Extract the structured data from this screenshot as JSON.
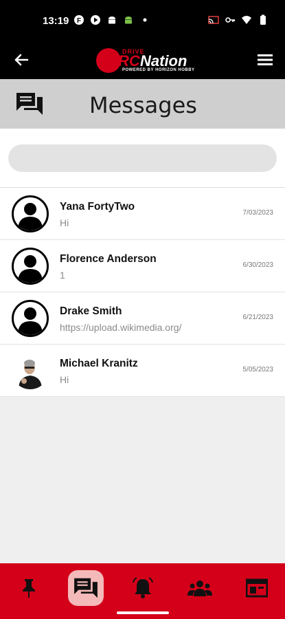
{
  "status_bar": {
    "time": "13:19"
  },
  "header": {
    "logo": {
      "drive": "DRIVE",
      "rc": "RC",
      "nation": "Nation",
      "powered": "POWERED BY HORIZON HOBBY"
    }
  },
  "page": {
    "title": "Messages"
  },
  "search": {
    "value": "",
    "placeholder": ""
  },
  "conversations": [
    {
      "name": "Yana FortyTwo",
      "preview": "Hi",
      "date": "7/03/2023",
      "avatar": "default-avatar"
    },
    {
      "name": "Florence Anderson",
      "preview": "1",
      "date": "6/30/2023",
      "avatar": "default-avatar"
    },
    {
      "name": "Drake Smith",
      "preview": "https://upload.wikimedia.org/",
      "date": "6/21/2023",
      "avatar": "default-avatar"
    },
    {
      "name": "Michael Kranitz",
      "preview": "Hi",
      "date": "5/05/2023",
      "avatar": "photo-avatar"
    }
  ],
  "bottom_nav": {
    "items": [
      {
        "icon": "pin-icon",
        "active": false
      },
      {
        "icon": "messages-icon",
        "active": true
      },
      {
        "icon": "bell-icon",
        "active": false
      },
      {
        "icon": "group-icon",
        "active": false
      },
      {
        "icon": "browser-icon",
        "active": false
      }
    ]
  },
  "colors": {
    "brand_red": "#d4001a",
    "header_black": "#000000",
    "title_bar_gray": "#cfcfcf",
    "active_nav": "#f4b9b9"
  }
}
